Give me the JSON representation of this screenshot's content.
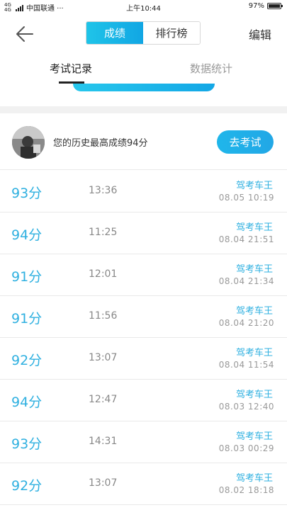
{
  "status_bar": {
    "network": "4G 4G",
    "carrier": "中国联通 ···",
    "time": "上午10:44",
    "battery_text": "97%",
    "battery_level": 0.97
  },
  "header": {
    "tabs": [
      {
        "label": "成绩",
        "active": true
      },
      {
        "label": "排行榜",
        "active": false
      }
    ],
    "edit_label": "编辑"
  },
  "subtabs": [
    {
      "label": "考试记录",
      "active": true
    },
    {
      "label": "数据统计",
      "active": false
    }
  ],
  "best": {
    "text": "您的历史最高成绩94分",
    "button_label": "去考试"
  },
  "records": [
    {
      "score": "93分",
      "duration": "13:36",
      "mode": "驾考车王",
      "date": "08.05  10:19"
    },
    {
      "score": "94分",
      "duration": "11:25",
      "mode": "驾考车王",
      "date": "08.04  21:51"
    },
    {
      "score": "91分",
      "duration": "12:01",
      "mode": "驾考车王",
      "date": "08.04  21:34"
    },
    {
      "score": "91分",
      "duration": "11:56",
      "mode": "驾考车王",
      "date": "08.04  21:20"
    },
    {
      "score": "92分",
      "duration": "13:07",
      "mode": "驾考车王",
      "date": "08.04  11:54"
    },
    {
      "score": "94分",
      "duration": "12:47",
      "mode": "驾考车王",
      "date": "08.03  12:40"
    },
    {
      "score": "93分",
      "duration": "14:31",
      "mode": "驾考车王",
      "date": "08.03  00:29"
    },
    {
      "score": "92分",
      "duration": "13:07",
      "mode": "驾考车王",
      "date": "08.02  18:18"
    }
  ],
  "colors": {
    "accent": "#1fb6ea",
    "score_text": "#2fb0e0"
  },
  "icons": {
    "back": "arrow-left-icon"
  }
}
